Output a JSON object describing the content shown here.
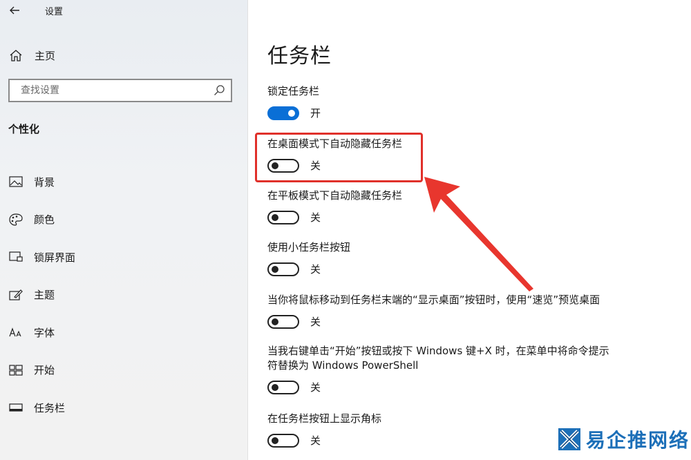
{
  "window": {
    "title": "设置"
  },
  "sidebar": {
    "home_label": "主页",
    "search_placeholder": "查找设置",
    "section_title": "个性化",
    "items": [
      {
        "label": "背景",
        "icon": "picture-icon"
      },
      {
        "label": "颜色",
        "icon": "palette-icon"
      },
      {
        "label": "锁屏界面",
        "icon": "lock-screen-icon"
      },
      {
        "label": "主题",
        "icon": "theme-icon"
      },
      {
        "label": "字体",
        "icon": "font-icon"
      },
      {
        "label": "开始",
        "icon": "start-icon"
      },
      {
        "label": "任务栏",
        "icon": "taskbar-icon"
      }
    ]
  },
  "main": {
    "title": "任务栏",
    "settings": [
      {
        "label": "锁定任务栏",
        "state": "开",
        "on": true
      },
      {
        "label": "在桌面模式下自动隐藏任务栏",
        "state": "关",
        "on": false
      },
      {
        "label": "在平板模式下自动隐藏任务栏",
        "state": "关",
        "on": false
      },
      {
        "label": "使用小任务栏按钮",
        "state": "关",
        "on": false
      },
      {
        "label": "当你将鼠标移动到任务栏末端的“显示桌面”按钮时，使用“速览”预览桌面",
        "state": "关",
        "on": false
      },
      {
        "label": "当我右键单击“开始”按钮或按下 Windows 键+X 时，在菜单中将命令提示符替换为 Windows PowerShell",
        "state": "关",
        "on": false
      },
      {
        "label": "在任务栏按钮上显示角标",
        "state": "关",
        "on": false
      }
    ]
  },
  "colors": {
    "accent": "#0a6fd6",
    "highlight": "#e0302a",
    "watermark": "#1c6fb8"
  },
  "watermark": {
    "text": "易企推网络"
  }
}
